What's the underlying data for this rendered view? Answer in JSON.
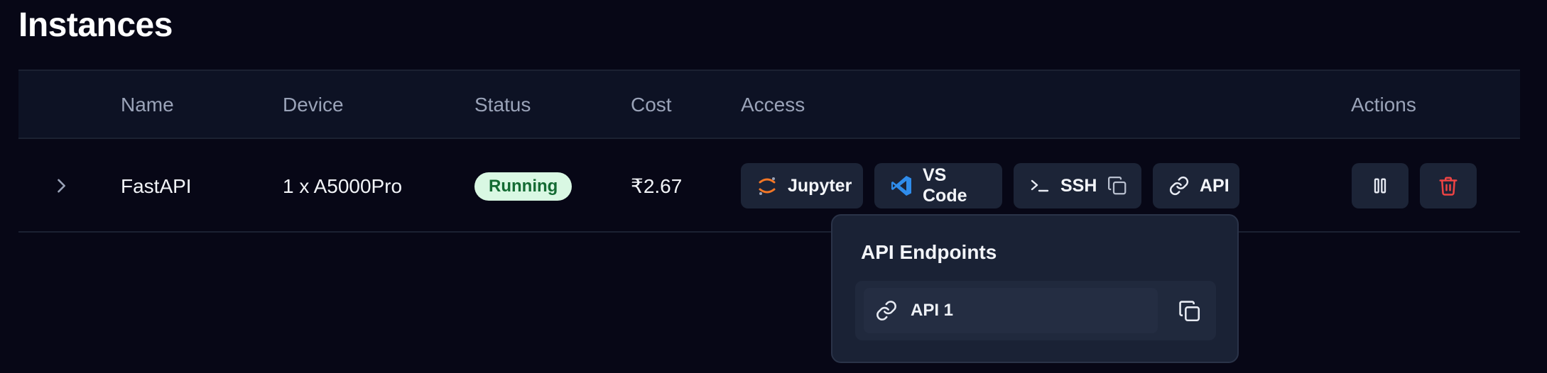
{
  "page": {
    "title": "Instances"
  },
  "table": {
    "columns": [
      "Name",
      "Device",
      "Status",
      "Cost",
      "Access",
      "Actions"
    ],
    "rows": [
      {
        "name": "FastAPI",
        "device": "1 x A5000Pro",
        "status": "Running",
        "cost": "₹2.67",
        "access": {
          "jupyter": "Jupyter",
          "vscode": "VS Code",
          "ssh": "SSH",
          "api": "API"
        }
      }
    ]
  },
  "popover": {
    "title": "API Endpoints",
    "endpoints": [
      {
        "label": "API 1"
      }
    ]
  },
  "colors": {
    "background": "#070716",
    "header_bg": "#0d1224",
    "button_bg": "#1c2437",
    "status_bg": "#d9f8e3",
    "status_text": "#146b33",
    "jupyter_orange": "#f37726",
    "vscode_blue": "#2f8ceb",
    "delete_red": "#ef4444"
  },
  "icons": [
    "chevron-right-icon",
    "jupyter-icon",
    "vscode-icon",
    "terminal-icon",
    "copy-icon",
    "link-icon",
    "pause-icon",
    "trash-icon"
  ]
}
